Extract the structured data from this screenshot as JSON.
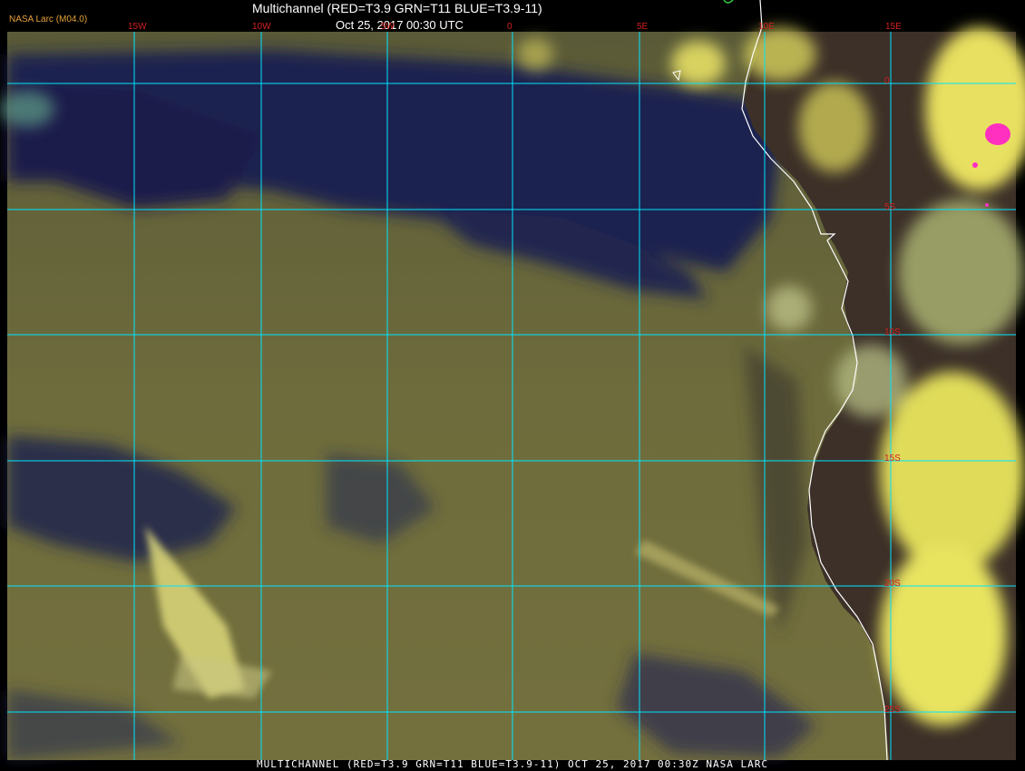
{
  "header": {
    "title": "Multichannel (RED=T3.9 GRN=T11 BLUE=T3.9-11)",
    "datetime": "Oct 25, 2017 00:30 UTC",
    "agency": "NASA Larc (M04.0)"
  },
  "footer": {
    "caption": "MULTICHANNEL (RED=T3.9 GRN=T11 BLUE=T3.9-11) OCT 25, 2017 00:30Z  NASA LARC"
  },
  "grid": {
    "longitudes": [
      "15W",
      "10W",
      "5W",
      "0",
      "5E",
      "10E",
      "15E"
    ],
    "latitudes": [
      "0",
      "5S",
      "10S",
      "15S",
      "20S",
      "25S"
    ]
  },
  "colors": {
    "ocean_clear": "#1a1f52",
    "stratocumulus": "#6b6b3a",
    "high_cloud": "#e8e060",
    "land": "#3a2e28",
    "grid_line": "#00e5ff",
    "coastline": "#ffffff",
    "grid_label": "#d42020",
    "cold_cloud_top": "#ff30c0"
  }
}
